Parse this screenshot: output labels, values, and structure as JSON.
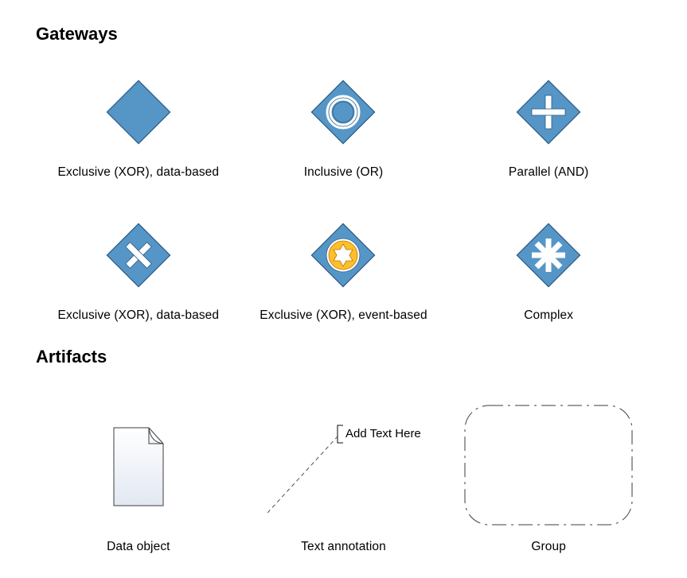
{
  "sections": {
    "gateways": {
      "title": "Gateways",
      "items": [
        {
          "label": "Exclusive (XOR), data-based",
          "type": "diamond-plain"
        },
        {
          "label": "Inclusive (OR)",
          "type": "diamond-circle"
        },
        {
          "label": "Parallel (AND)",
          "type": "diamond-plus"
        },
        {
          "label": "Exclusive (XOR), data-based",
          "type": "diamond-x"
        },
        {
          "label": "Exclusive (XOR), event-based",
          "type": "diamond-star"
        },
        {
          "label": "Complex",
          "type": "diamond-asterisk"
        }
      ]
    },
    "artifacts": {
      "title": "Artifacts",
      "annotation_text": "Add Text Here",
      "items": [
        {
          "label": "Data object",
          "type": "data-object"
        },
        {
          "label": "Text annotation",
          "type": "text-annotation"
        },
        {
          "label": "Group",
          "type": "group"
        }
      ]
    }
  },
  "colors": {
    "blue": "#5596c7",
    "blue_stroke": "#2a5a86",
    "orange": "#f7a800",
    "orange_inner": "#ffbe2b",
    "grey_stroke": "#3d3d3d"
  }
}
